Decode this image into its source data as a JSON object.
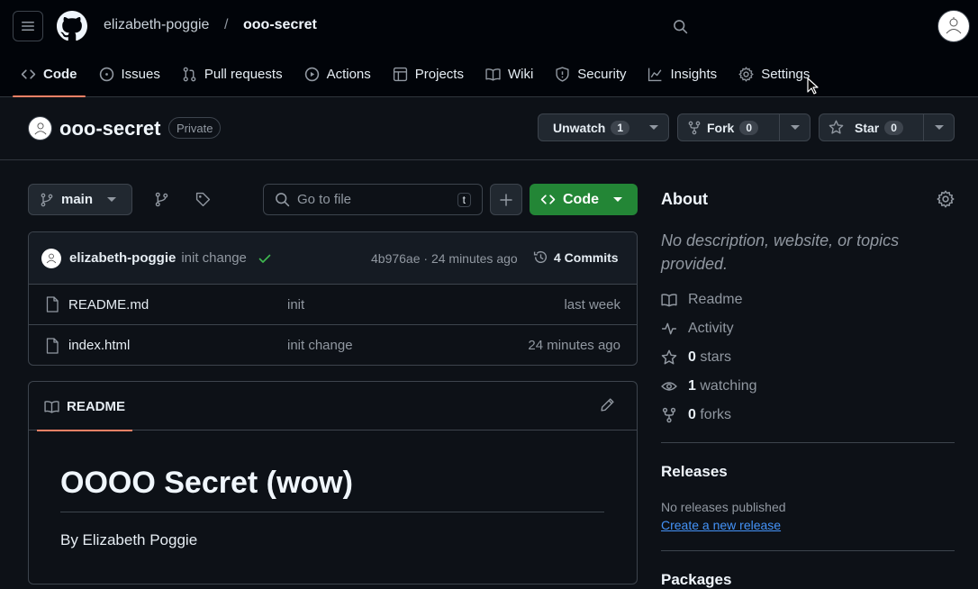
{
  "header": {
    "owner": "elizabeth-poggie",
    "separator": "/",
    "repo": "ooo-secret"
  },
  "tabs": [
    {
      "label": "Code",
      "icon": "code-icon",
      "active": true
    },
    {
      "label": "Issues",
      "icon": "issue-icon"
    },
    {
      "label": "Pull requests",
      "icon": "pull-request-icon"
    },
    {
      "label": "Actions",
      "icon": "play-icon"
    },
    {
      "label": "Projects",
      "icon": "table-icon"
    },
    {
      "label": "Wiki",
      "icon": "book-icon"
    },
    {
      "label": "Security",
      "icon": "shield-icon"
    },
    {
      "label": "Insights",
      "icon": "graph-icon"
    },
    {
      "label": "Settings",
      "icon": "gear-icon"
    }
  ],
  "repo": {
    "name": "ooo-secret",
    "visibility": "Private",
    "watch_label": "Unwatch",
    "watch_count": "1",
    "fork_label": "Fork",
    "fork_count": "0",
    "star_label": "Star",
    "star_count": "0"
  },
  "toolbar": {
    "branch": "main",
    "search_placeholder": "Go to file",
    "search_shortcut": "t",
    "code_label": "Code"
  },
  "commit": {
    "author": "elizabeth-poggie",
    "message": "init change",
    "meta": "4b976ae · 24 minutes ago",
    "commits_label": "4 Commits"
  },
  "files": [
    {
      "name": "README.md",
      "message": "init",
      "date": "last week"
    },
    {
      "name": "index.html",
      "message": "init change",
      "date": "24 minutes ago"
    }
  ],
  "readme": {
    "tab_label": "README",
    "heading": "OOOO Secret (wow)",
    "paragraph": "By Elizabeth Poggie"
  },
  "about": {
    "title": "About",
    "description": "No description, website, or topics provided.",
    "readme_label": "Readme",
    "activity_label": "Activity",
    "stars_count": "0",
    "stars_label": "stars",
    "watching_count": "1",
    "watching_label": "watching",
    "forks_count": "0",
    "forks_label": "forks"
  },
  "releases": {
    "title": "Releases",
    "none_text": "No releases published",
    "create_link": "Create a new release"
  },
  "packages": {
    "title": "Packages"
  },
  "colors": {
    "accent_tab": "#f78166",
    "code_button": "#238636",
    "link": "#4493f8",
    "success": "#3fb950"
  }
}
